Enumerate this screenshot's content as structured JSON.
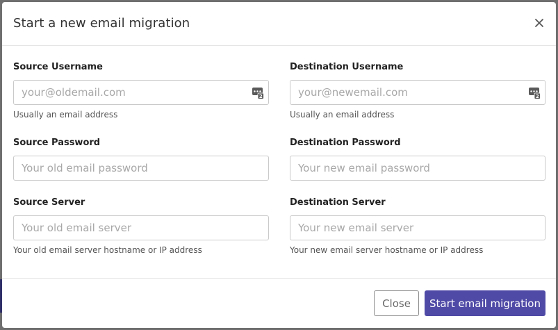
{
  "dialog": {
    "title": "Start a new email migration",
    "close_icon": "close-icon"
  },
  "source": {
    "username": {
      "label": "Source Username",
      "placeholder": "your@oldemail.com",
      "value": "",
      "help": "Usually an email address",
      "icon": "password-manager-icon"
    },
    "password": {
      "label": "Source Password",
      "placeholder": "Your old email password",
      "value": ""
    },
    "server": {
      "label": "Source Server",
      "placeholder": "Your old email server",
      "value": "",
      "help": "Your old email server hostname or IP address"
    }
  },
  "destination": {
    "username": {
      "label": "Destination Username",
      "placeholder": "your@newemail.com",
      "value": "",
      "help": "Usually an email address",
      "icon": "password-manager-icon"
    },
    "password": {
      "label": "Destination Password",
      "placeholder": "Your new email password",
      "value": ""
    },
    "server": {
      "label": "Destination Server",
      "placeholder": "Your new email server",
      "value": "",
      "help": "Your new email server hostname or IP address"
    }
  },
  "footer": {
    "close_label": "Close",
    "submit_label": "Start email migration"
  },
  "colors": {
    "primary": "#4f4aa6",
    "backdrop": "#6f6f6f"
  }
}
